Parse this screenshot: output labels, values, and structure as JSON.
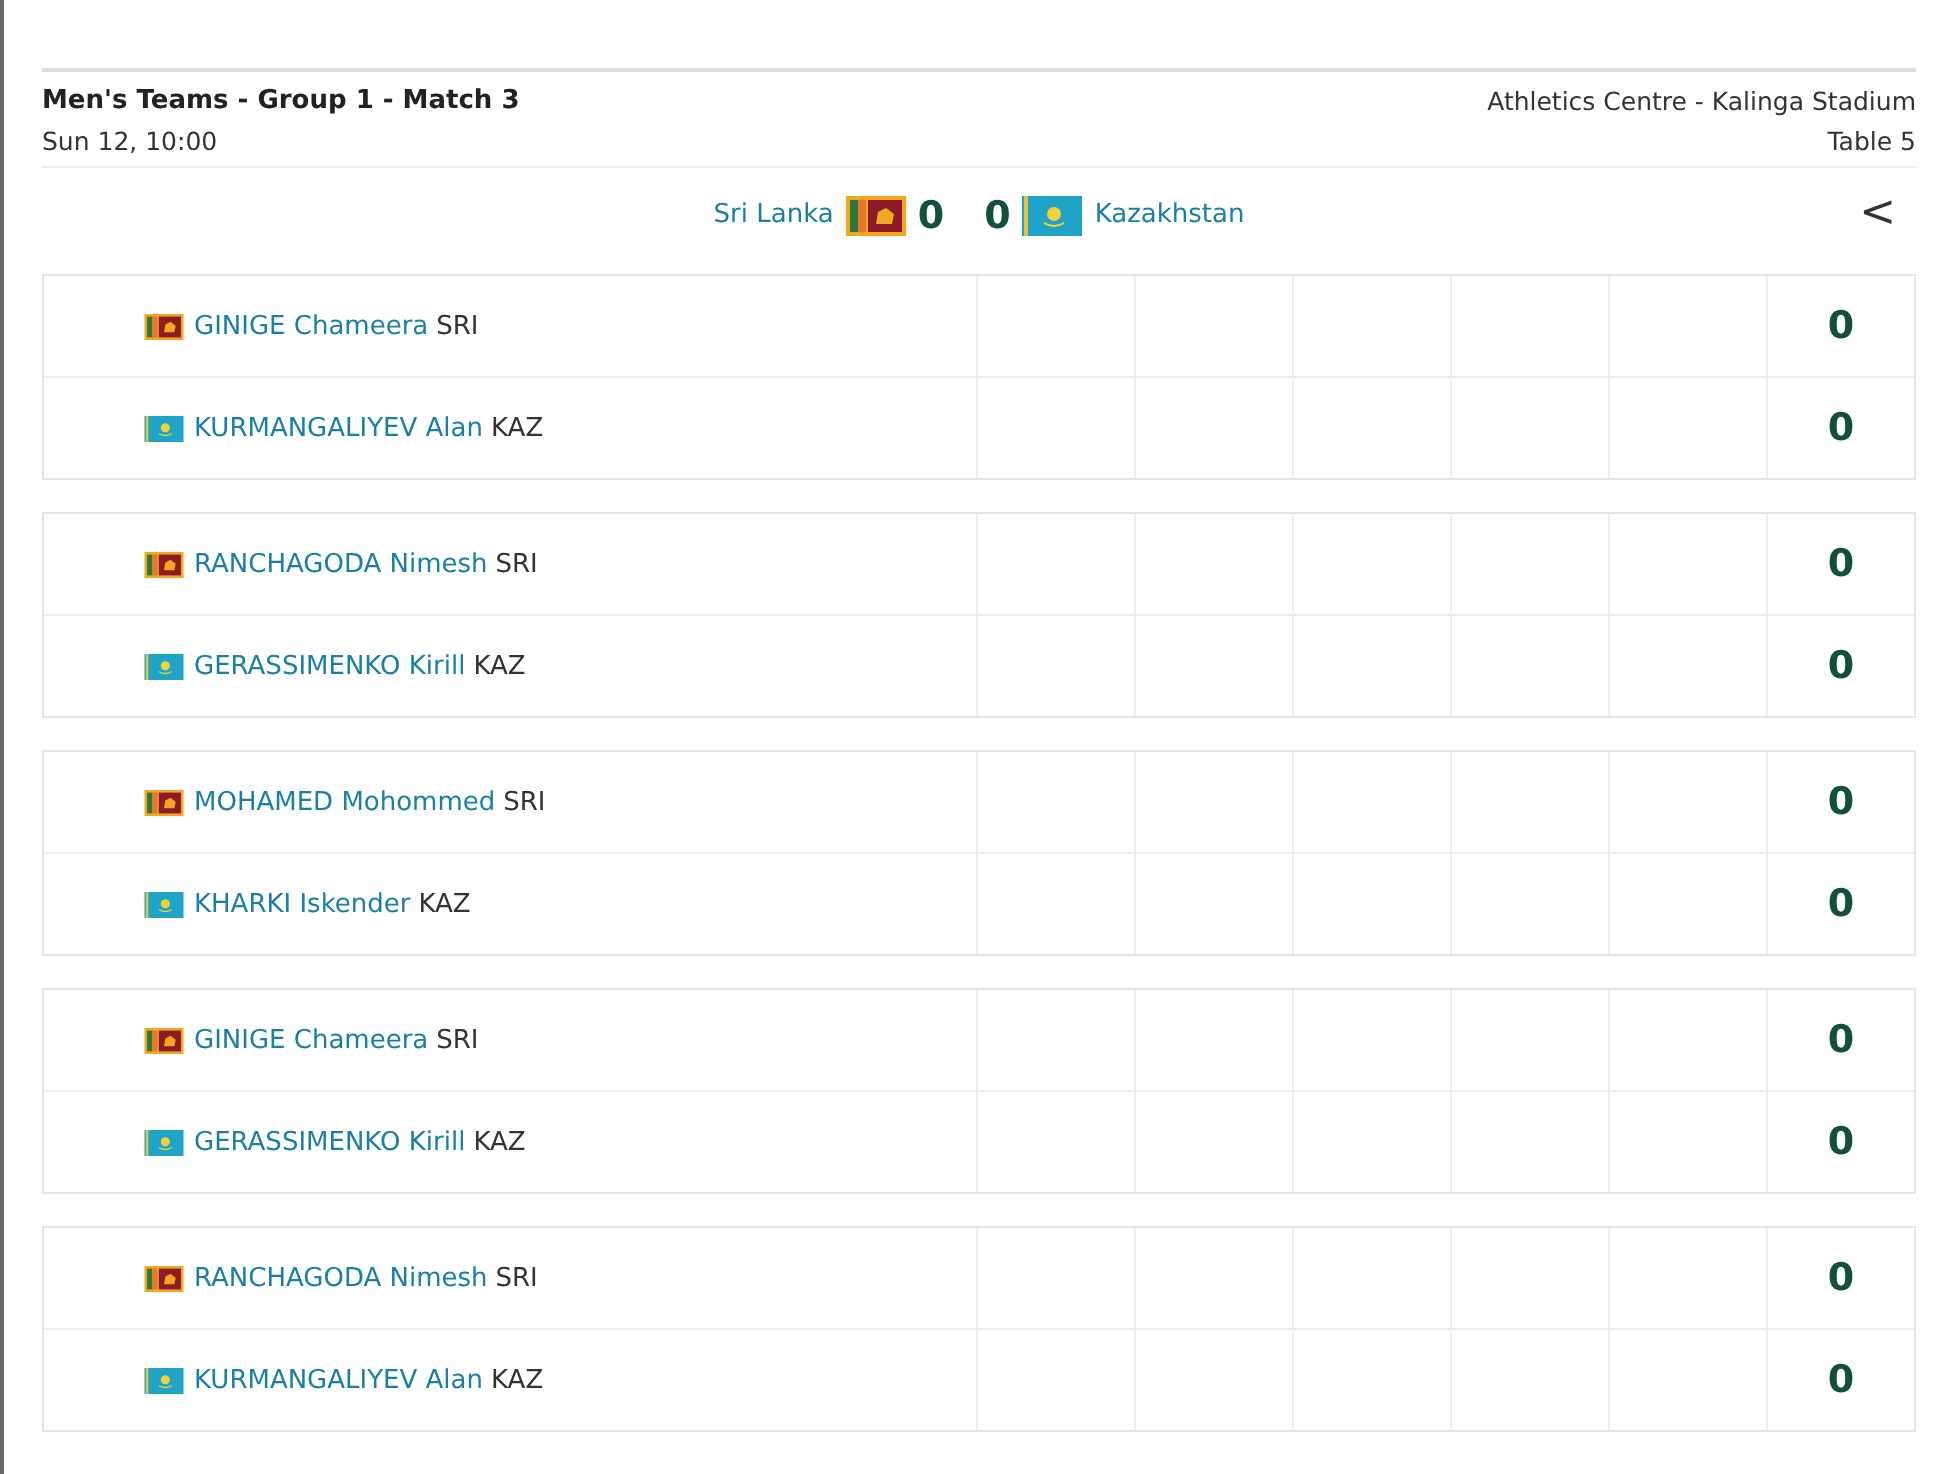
{
  "match": {
    "title": "Men's Teams - Group 1 - Match 3",
    "datetime": "Sun 12, 10:00",
    "venue": "Athletics Centre - Kalinga Stadium",
    "table": "Table 5"
  },
  "score": {
    "home": {
      "name": "Sri Lanka",
      "kind": "sri",
      "points": "0"
    },
    "away": {
      "name": "Kazakhstan",
      "kind": "kaz",
      "points": "0"
    },
    "back": "<"
  },
  "games": [
    {
      "players": [
        {
          "name": "GINIGE Chameera",
          "code": "SRI",
          "kind": "sri",
          "total": "0"
        },
        {
          "name": "KURMANGALIYEV Alan",
          "code": "KAZ",
          "kind": "kaz",
          "total": "0"
        }
      ]
    },
    {
      "players": [
        {
          "name": "RANCHAGODA Nimesh",
          "code": "SRI",
          "kind": "sri",
          "total": "0"
        },
        {
          "name": "GERASSIMENKO Kirill",
          "code": "KAZ",
          "kind": "kaz",
          "total": "0"
        }
      ]
    },
    {
      "players": [
        {
          "name": "MOHAMED Mohommed",
          "code": "SRI",
          "kind": "sri",
          "total": "0"
        },
        {
          "name": "KHARKI Iskender",
          "code": "KAZ",
          "kind": "kaz",
          "total": "0"
        }
      ]
    },
    {
      "players": [
        {
          "name": "GINIGE Chameera",
          "code": "SRI",
          "kind": "sri",
          "total": "0"
        },
        {
          "name": "GERASSIMENKO Kirill",
          "code": "KAZ",
          "kind": "kaz",
          "total": "0"
        }
      ]
    },
    {
      "players": [
        {
          "name": "RANCHAGODA Nimesh",
          "code": "SRI",
          "kind": "sri",
          "total": "0"
        },
        {
          "name": "KURMANGALIYEV Alan",
          "code": "KAZ",
          "kind": "kaz",
          "total": "0"
        }
      ]
    }
  ]
}
